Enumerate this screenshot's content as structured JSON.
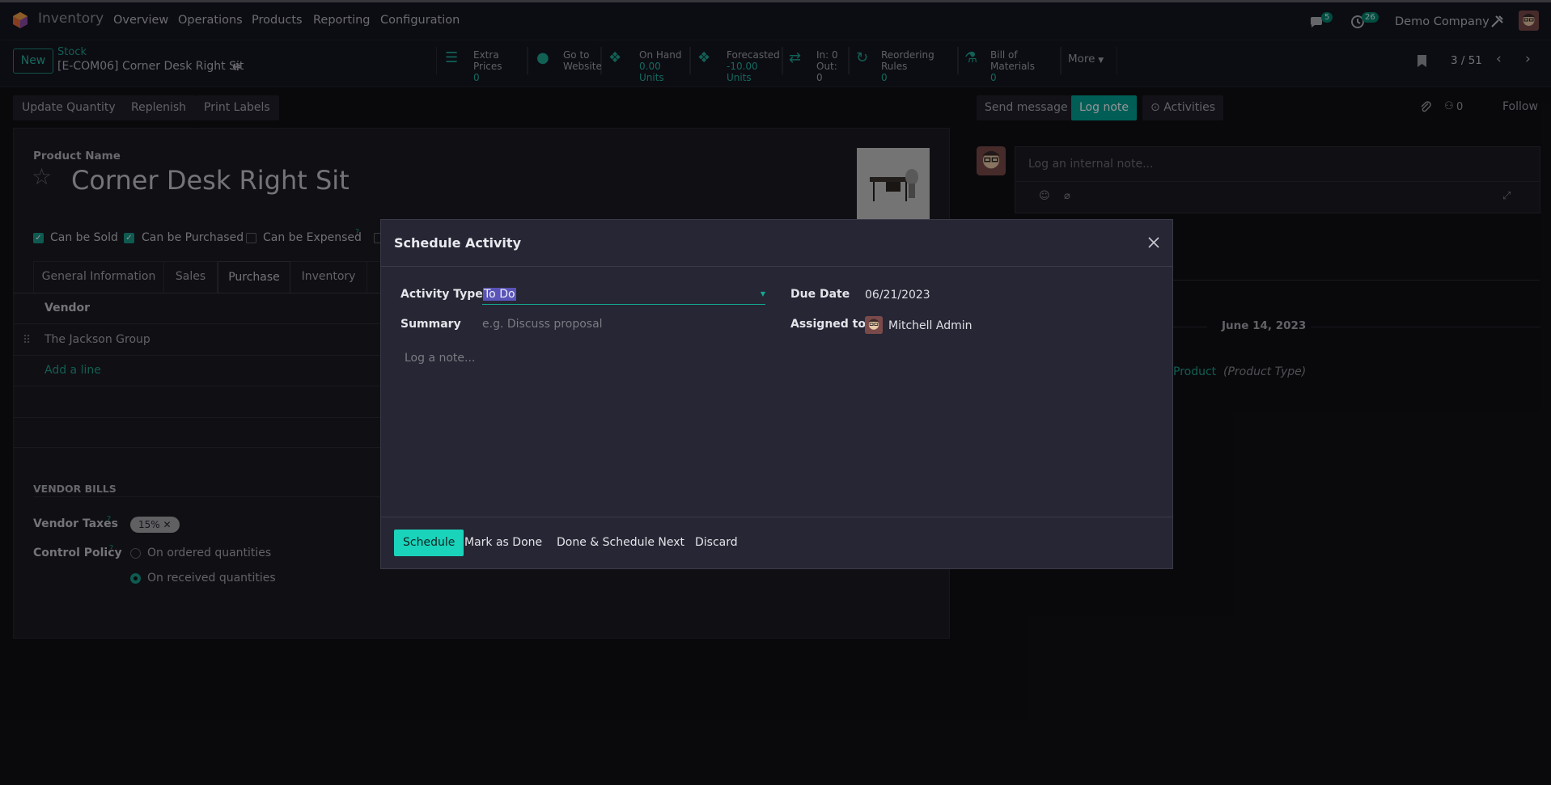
{
  "nav": {
    "app_name": "Inventory",
    "menu": [
      "Overview",
      "Operations",
      "Products",
      "Reporting",
      "Configuration"
    ],
    "messages_badge": "5",
    "activities_badge": "26",
    "company": "Demo Company"
  },
  "control_panel": {
    "new_label": "New",
    "breadcrumb_parent": "Stock",
    "breadcrumb_current": "[E-COM06] Corner Desk Right Sit",
    "smart_buttons": [
      {
        "label": "Extra Prices",
        "value": "0",
        "icon": "list-icon"
      },
      {
        "label": "Go to",
        "value": "Website",
        "icon": "globe-icon"
      },
      {
        "label": "On Hand",
        "value": "0.00 Units",
        "icon": "cubes-icon"
      },
      {
        "label": "Forecasted",
        "value": "-10.00 Units",
        "icon": "cubes-icon"
      },
      {
        "label": "In: 0",
        "value": "Out: 0",
        "icon": "exchange-icon"
      },
      {
        "label": "Reordering Rules",
        "value": "0",
        "icon": "refresh-icon"
      },
      {
        "label": "Bill of Materials",
        "value": "0",
        "icon": "flask-icon"
      }
    ],
    "more_label": "More",
    "pager": "3 / 51"
  },
  "actions": [
    "Update Quantity",
    "Replenish",
    "Print Labels"
  ],
  "form": {
    "product_name_label": "Product Name",
    "product_name": "Corner Desk Right Sit",
    "checkboxes": [
      {
        "label": "Can be Sold",
        "checked": true
      },
      {
        "label": "Can be Purchased",
        "checked": true
      },
      {
        "label": "Can be Expensed",
        "checked": false
      }
    ],
    "tabs": [
      "General Information",
      "Sales",
      "Purchase",
      "Inventory"
    ],
    "active_tab": "Purchase",
    "vendor_header": "Vendor",
    "vendor_row": "The Jackson Group",
    "add_line": "Add a line",
    "vendor_bills_title": "VENDOR BILLS",
    "vendor_taxes_label": "Vendor Taxes",
    "vendor_tax_tag": "15%",
    "control_policy_label": "Control Policy",
    "control_policy_options": [
      "On ordered quantities",
      "On received quantities"
    ],
    "control_policy_selected": "On received quantities"
  },
  "chatter": {
    "send_message": "Send message",
    "log_note": "Log note",
    "activities": "Activities",
    "followers_count": "0",
    "follow": "Follow",
    "note_placeholder": "Log an internal note...",
    "date_separator": "June 14, 2023",
    "tracking_value": "Product",
    "tracking_field": "(Product Type)"
  },
  "dialog": {
    "title": "Schedule Activity",
    "activity_type_label": "Activity Type",
    "activity_type_value": "To Do",
    "summary_label": "Summary",
    "summary_placeholder": "e.g. Discuss proposal",
    "due_date_label": "Due Date",
    "due_date_value": "06/21/2023",
    "assigned_label": "Assigned to",
    "assigned_value": "Mitchell Admin",
    "note_placeholder": "Log a note...",
    "schedule": "Schedule",
    "mark_done": "Mark as Done",
    "done_schedule_next": "Done & Schedule Next",
    "discard": "Discard"
  },
  "colors": {
    "accent": "#00a09d",
    "primary_btn": "#1ad3bb",
    "background": "#111116"
  }
}
